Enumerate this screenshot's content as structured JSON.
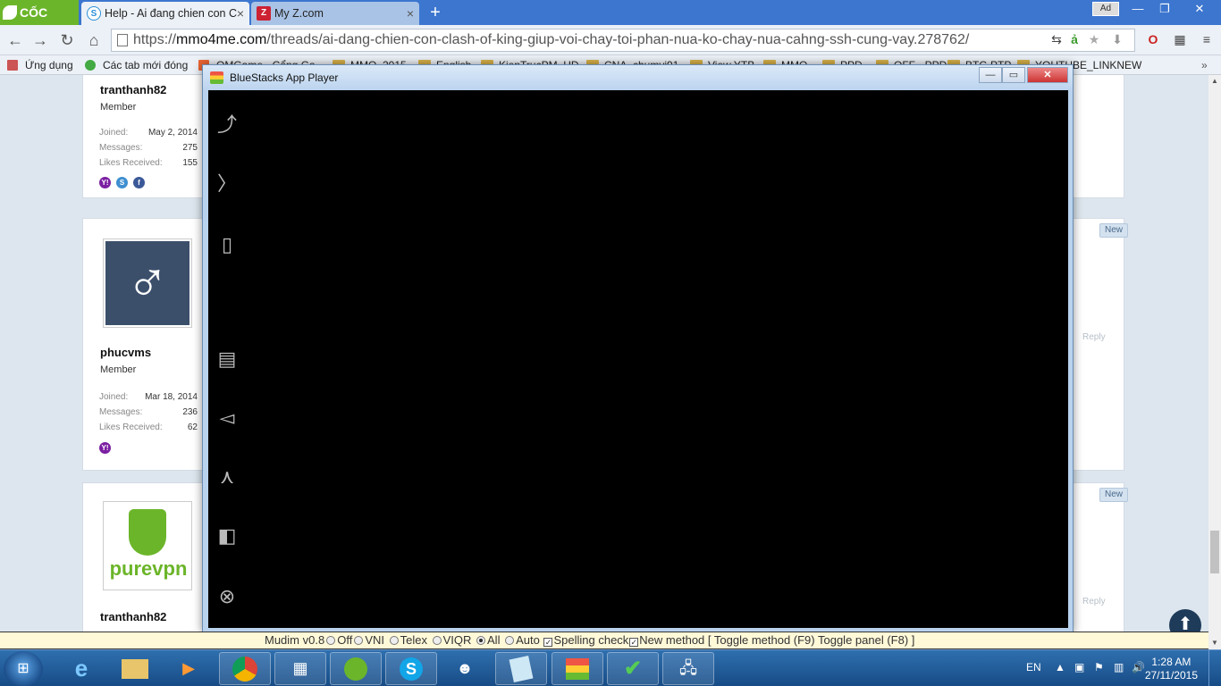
{
  "browser": {
    "brand": "CỐC CỐC",
    "tabs": [
      {
        "title": "Help - Ai đang chien con C",
        "icon": "S",
        "active": true
      },
      {
        "title": "My Z.com",
        "icon": "Z",
        "active": false
      }
    ],
    "ad_button": "Ad",
    "url_prefix": "https://",
    "url_domain": "mmo4me.com",
    "url_path": "/threads/ai-dang-chien-con-clash-of-king-giup-voi-chay-toi-phan-nua-ko-chay-nua-cahng-ssh-cung-vay.278762/",
    "bookmarks": [
      "Ứng dụng",
      "Các tab mới đóng",
      "OMGame - Cổng Ga...",
      "MMO_2015",
      "English",
      "KienTrucPM_HD",
      "CNA_chumvi91",
      "View YTB",
      "MMO",
      "PPD",
      "OFF - PPD",
      "BTC-PTP",
      "YOUTUBE_LINKNEW"
    ]
  },
  "forum": {
    "posts": [
      {
        "username": "tranthanh82",
        "role": "Member",
        "joined_label": "Joined:",
        "joined": "May 2, 2014",
        "messages_label": "Messages:",
        "messages": "275",
        "likes_label": "Likes Received:",
        "likes": "155"
      },
      {
        "username": "phucvms",
        "role": "Member",
        "joined_label": "Joined:",
        "joined": "Mar 18, 2014",
        "messages_label": "Messages:",
        "messages": "236",
        "likes_label": "Likes Received:",
        "likes": "62"
      },
      {
        "username": "tranthanh82",
        "logo_text": "purevpn"
      }
    ],
    "new_badge": "New",
    "reply_label": "Reply"
  },
  "bluestacks": {
    "title": "BlueStacks App Player"
  },
  "mudim": {
    "version": "Mudim v0.8",
    "off": "Off",
    "vni": "VNI",
    "telex": "Telex",
    "viqr": "VIQR",
    "all": "All",
    "auto": "Auto",
    "spelling": "Spelling check",
    "newmethod": "New method",
    "toggles": "[ Toggle method (F9) Toggle panel (F8) ]"
  },
  "taskbar": {
    "language": "EN",
    "time": "1:28 AM",
    "date": "27/11/2015"
  },
  "colors": {
    "tabstrip": "#3c76cf",
    "brand_green": "#6bb52a",
    "taskbar": "#174c86",
    "mudim_bg": "#fff9d8"
  }
}
